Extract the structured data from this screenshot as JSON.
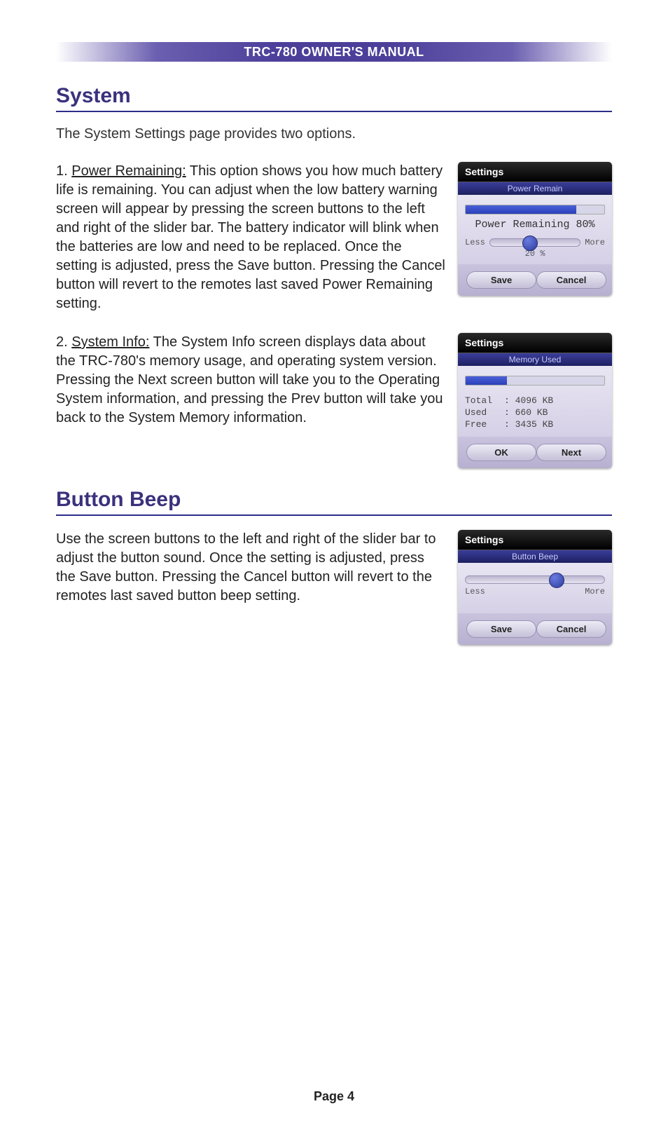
{
  "header": {
    "title": "TRC-780 OWNER'S MANUAL"
  },
  "sections": {
    "system": {
      "heading": "System",
      "intro": "The System Settings page provides two options.",
      "item1": {
        "num": "1. ",
        "label": "Power Remaining:",
        "text": " This option shows you how much battery life is remaining. You can adjust when the low battery warning screen will appear by pressing the screen buttons to the left and right of the slider bar. The battery indicator will blink when the batteries are low and need to be replaced. Once the setting is adjusted, press the Save button. Pressing the Cancel button will revert to the remotes last saved Power Remaining setting."
      },
      "item2": {
        "num": "2. ",
        "label": "System Info:",
        "text": " The System Info screen displays data about the TRC-780's memory usage, and operating system version. Pressing the Next screen button will take you to the Operating System information, and pressing the Prev button will take you back to the System Memory information."
      }
    },
    "beep": {
      "heading": "Button Beep",
      "text": "Use the screen buttons to the left and right of the slider bar to adjust the button sound. Once the setting is adjusted, press the Save button. Pressing the Cancel button will revert to the remotes last saved button beep setting."
    }
  },
  "fig_power": {
    "hdr": "Settings",
    "sub": "Power Remain",
    "remaining_label": "Power Remaining 80%",
    "less": "Less",
    "more": "More",
    "slider_value": "20 %",
    "save": "Save",
    "cancel": "Cancel"
  },
  "fig_mem": {
    "hdr": "Settings",
    "sub": "Memory Used",
    "rows": {
      "total_k": "Total",
      "total_v": ": 4096 KB",
      "used_k": "Used",
      "used_v": ": 660 KB",
      "free_k": "Free",
      "free_v": ": 3435 KB"
    },
    "ok": "OK",
    "next": "Next"
  },
  "fig_beep": {
    "hdr": "Settings",
    "sub": "Button Beep",
    "less": "Less",
    "more": "More",
    "save": "Save",
    "cancel": "Cancel"
  },
  "footer": {
    "page": "Page 4"
  }
}
